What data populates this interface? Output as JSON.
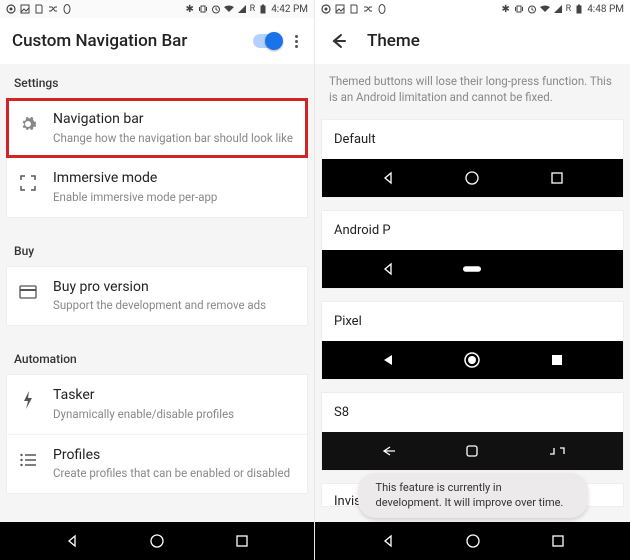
{
  "left": {
    "status": {
      "time": "4:42 PM",
      "net": "R"
    },
    "app_title": "Custom Navigation Bar",
    "sections": {
      "settings": {
        "label": "Settings",
        "items": [
          {
            "title": "Navigation bar",
            "sub": "Change how the navigation bar should look like"
          },
          {
            "title": "Immersive mode",
            "sub": "Enable immersive mode per-app"
          }
        ]
      },
      "buy": {
        "label": "Buy",
        "items": [
          {
            "title": "Buy pro version",
            "sub": "Support the development and remove ads"
          }
        ]
      },
      "automation": {
        "label": "Automation",
        "items": [
          {
            "title": "Tasker",
            "sub": "Dynamically enable/disable profiles"
          },
          {
            "title": "Profiles",
            "sub": "Create profiles that can be enabled or disabled"
          }
        ]
      }
    }
  },
  "right": {
    "status": {
      "time": "4:48 PM",
      "net": "R"
    },
    "app_title": "Theme",
    "warning": "Themed buttons will lose their long-press function. This is an Android limitation and cannot be fixed.",
    "themes": [
      {
        "name": "Default"
      },
      {
        "name": "Android P"
      },
      {
        "name": "Pixel"
      },
      {
        "name": "S8"
      }
    ],
    "partial_theme": "Invisi",
    "toast": "This feature is currently in development. It will improve over time."
  }
}
